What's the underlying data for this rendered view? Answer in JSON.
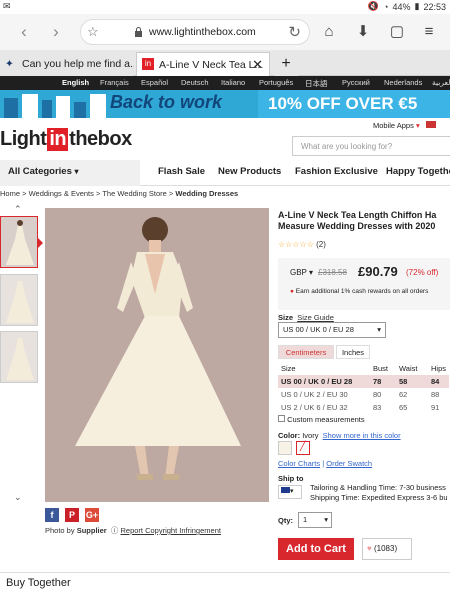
{
  "status": {
    "left_icon": "mail-icon",
    "battery": "44%",
    "time": "22:53"
  },
  "browser": {
    "url": "www.lightinthebox.com",
    "tabs": [
      {
        "title": "Can you help me find a...",
        "active": false
      },
      {
        "title": "A-Line V Neck Tea L...",
        "active": true
      }
    ]
  },
  "langs": [
    "English",
    "Français",
    "Español",
    "Deutsch",
    "Italiano",
    "Português",
    "日本語",
    "Русский",
    "Nederlands",
    "العربية"
  ],
  "banner": {
    "left": "Back to work",
    "right": "10% OFF OVER €5"
  },
  "header": {
    "logo_a": "Light",
    "logo_b": "in",
    "logo_c": "thebox",
    "mobile_apps": "Mobile Apps",
    "search_placeholder": "What are you looking for?"
  },
  "nav": {
    "all_categories": "All Categories",
    "items": [
      "Flash Sale",
      "New Products",
      "Fashion Exclusive",
      "Happy Together"
    ]
  },
  "breadcrumb": {
    "home": "Home",
    "c1": "Weddings & Events",
    "c2": "The Wedding Store",
    "c3": "Wedding Dresses"
  },
  "product": {
    "title_l1": "A-Line V Neck Tea Length Chiffon Ha",
    "title_l2": "Measure Wedding Dresses with 2020",
    "reviews": "(2)",
    "currency": "GBP",
    "old_price": "£318.58",
    "price": "£90.79",
    "discount": "(72% off)",
    "cash_text": "Earn additional 1% cash rewards on all orders",
    "size_label": "Size",
    "size_guide": "Size Guide",
    "size_value": "US 00 / UK 0 / EU 28",
    "unit_cm": "Centimeters",
    "unit_in": "Inches",
    "table_head": [
      "Size",
      "Bust",
      "Waist",
      "Hips"
    ],
    "rows": [
      [
        "US 00 / UK 0 / EU 28",
        "78",
        "58",
        "84"
      ],
      [
        "US 0 / UK 2 / EU 30",
        "80",
        "62",
        "88"
      ],
      [
        "US 2 / UK 6 / EU 32",
        "83",
        "65",
        "91"
      ]
    ],
    "custom": "Custom measurements",
    "color_label": "Color:",
    "color_value": "Ivory",
    "more_color": "Show more in this color",
    "color_charts": "Color Charts",
    "order_swatch": "Order Swatch",
    "ship_to": "Ship to",
    "tailoring": "Tailoring & Handling Time: 7-30 business",
    "shipping": "Shipping Time: Expedited Express 3-6 bu",
    "qty_label": "Qty:",
    "qty_value": "1",
    "add_to_cart": "Add to Cart",
    "likes": "(1083)",
    "photo_by": "Photo by",
    "supplier": "Supplier",
    "report": "Report Copyright Infringement"
  },
  "bottom": "Buy Together"
}
